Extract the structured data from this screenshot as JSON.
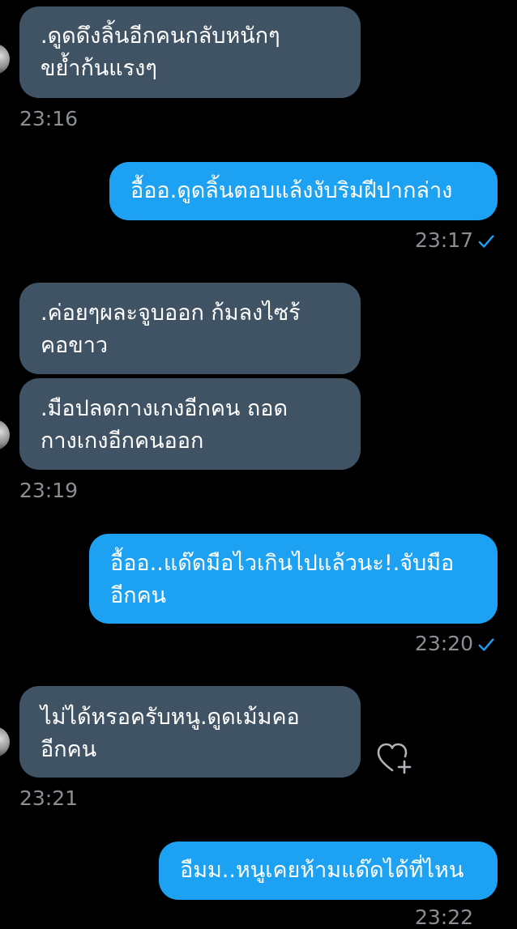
{
  "colors": {
    "background": "#000000",
    "incoming_bubble": "#3f5364",
    "outgoing_bubble": "#1da1f2",
    "timestamp": "#8a8f95",
    "read_check": "#1da1f2"
  },
  "messages": [
    {
      "direction": "incoming",
      "lines": [
        ".ดูดดึงลิ้นอีกคนกลับหนักๆ",
        "ขย้ำก้นแรงๆ"
      ],
      "time": "23:16",
      "avatar": "avatar"
    },
    {
      "direction": "outgoing",
      "lines": [
        "อื้ออ.ดูดลิ้นตอบแล้งงับริมฝีปากล่าง"
      ],
      "time": "23:17",
      "status_icon": "check-icon"
    },
    {
      "direction": "incoming",
      "lines": [
        ".ค่อยๆผละจูบออก ก้มลงไซร้",
        "คอขาว"
      ]
    },
    {
      "direction": "incoming",
      "lines": [
        ".มือปลดกางเกงอีกคน ถอด",
        "กางเกงอีกคนออก"
      ],
      "time": "23:19",
      "avatar": "avatar"
    },
    {
      "direction": "outgoing",
      "lines": [
        "อื้ออ..แด๊ดมือไวเกินไปแล้วนะ!.จับมือ",
        "อีกคน"
      ],
      "time": "23:20",
      "status_icon": "check-icon"
    },
    {
      "direction": "incoming",
      "lines": [
        "ไม่ได้หรอครับหนู.ดูดเม้มคอ",
        "อีกคน"
      ],
      "time": "23:21",
      "avatar": "avatar",
      "reaction_icon": "heart-plus-icon"
    },
    {
      "direction": "outgoing",
      "lines": [
        "อืมม..หนูเคยห้ามแด๊ดได้ที่ไหน"
      ],
      "time": "23:22"
    }
  ]
}
